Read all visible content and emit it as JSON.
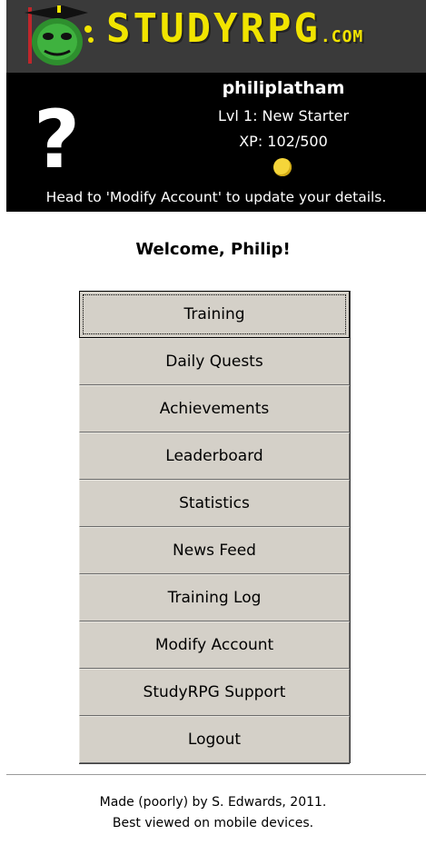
{
  "header": {
    "logo_main": "STUDYRPG",
    "logo_tld": ".COM",
    "brand_color": "#f1e400"
  },
  "profile": {
    "avatar_placeholder": "?",
    "username": "philiplatham",
    "level": "Lvl 1: New Starter",
    "xp": "XP: 102/500",
    "hint": "Head to 'Modify Account' to update your details."
  },
  "welcome": "Welcome, Philip!",
  "menu": [
    {
      "label": "Training"
    },
    {
      "label": "Daily Quests"
    },
    {
      "label": "Achievements"
    },
    {
      "label": "Leaderboard"
    },
    {
      "label": "Statistics"
    },
    {
      "label": "News Feed"
    },
    {
      "label": "Training Log"
    },
    {
      "label": "Modify Account"
    },
    {
      "label": "StudyRPG Support"
    },
    {
      "label": "Logout"
    }
  ],
  "footer": {
    "line1": "Made (poorly) by S. Edwards, 2011.",
    "line2": "Best viewed on mobile devices."
  }
}
